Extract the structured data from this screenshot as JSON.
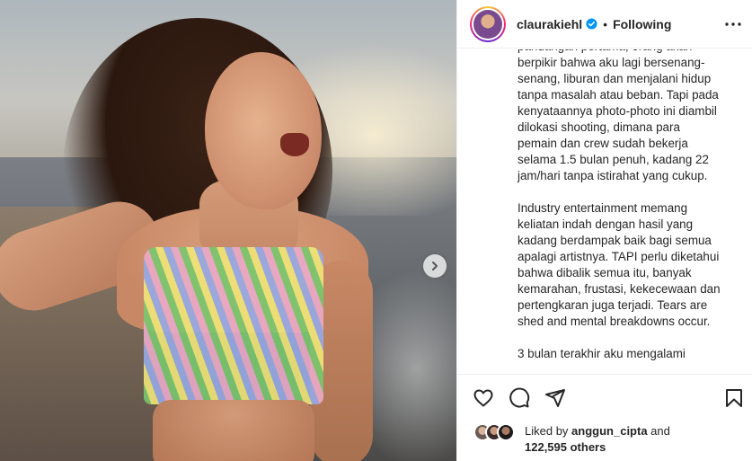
{
  "post": {
    "username": "claurakiehl",
    "separator": "•",
    "follow_status": "Following",
    "caption": "pandangan pertama, orang akan\nberpikir bahwa aku lagi bersenang-\nsenang, liburan dan menjalani hidup\ntanpa masalah atau beban. Tapi pada\nkenyataannya photo-photo ini diambil\ndilokasi shooting, dimana para\npemain dan crew sudah bekerja\nselama 1.5 bulan penuh, kadang 22\njam/hari tanpa istirahat yang cukup.\n\nIndustry entertainment memang\nkeliatan indah dengan hasil yang\nkadang berdampak baik bagi semua\napalagi artistnya. TAPI perlu diketahui\nbahwa dibalik semua itu, banyak\nkemarahan, frustasi, kekecewaan dan\npertengkaran juga terjadi. Tears are\nshed and mental breakdowns occur.\n\n3 bulan terakhir aku mengalami",
    "likes": {
      "prefix": "Liked by ",
      "liker": "anggun_cipta",
      "and": " and",
      "count": "122,595 others"
    }
  },
  "icons": {
    "verified": "verified-badge-icon",
    "more": "more-options-icon",
    "next": "chevron-right-icon",
    "like": "heart-icon",
    "comment": "comment-icon",
    "share": "share-icon",
    "save": "bookmark-icon"
  },
  "colors": {
    "verified": "#0095f6",
    "text": "#262626",
    "border": "#efefef"
  }
}
